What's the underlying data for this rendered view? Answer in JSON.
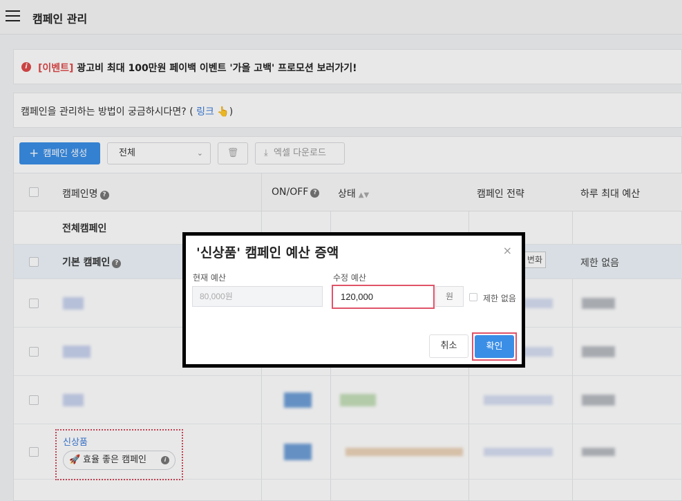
{
  "header": {
    "title": "캠페인 관리",
    "menu_icon": "hamburger-icon"
  },
  "event_banner": {
    "icon": "alert-circle-icon",
    "icon_glyph": "i",
    "tag": "[이벤트]",
    "text": " 광고비 최대 100만원 페이백 이벤트 '가을 고백' 프로모션 보러가기!"
  },
  "help": {
    "text_before": "캠페인을 관리하는 방법이 궁금하시다면? ( ",
    "link": "링크",
    "pointer": "👆",
    "text_after": ")"
  },
  "toolbar": {
    "create_plus": "+",
    "create_label": "캠페인 생성",
    "filter_value": "전체",
    "filter_chevron": "⌄",
    "delete_icon": "🗑",
    "excel_icon": "⤓",
    "excel_label": "엑셀 다운로드"
  },
  "table": {
    "columns": {
      "name": "캠페인명",
      "onoff": "ON/OFF",
      "status": "상태",
      "strategy": "캠페인 전략",
      "daily_budget": "하루 최대 예산"
    },
    "help_glyph": "?",
    "sort_glyph": "▲▼",
    "row_all": {
      "name": "전체캠페인"
    },
    "row_basic": {
      "name": "기본 캠페인",
      "strategy_partial": "변화",
      "daily_budget": "제한 없음"
    },
    "highlight_row": {
      "name": "신상품",
      "badge": "효율 좋은 캠페인",
      "badge_icon": "🚀",
      "badge_info": "i"
    }
  },
  "modal": {
    "title": "'신상품' 캠페인 예산 증액",
    "close": "×",
    "current_label": "현재 예산",
    "current_value": "80,000원",
    "new_label": "수정 예산",
    "new_value": "120,000",
    "unit": "원",
    "no_limit_label": "제한 없음",
    "no_limit_checked": false,
    "cancel_label": "취소",
    "confirm_label": "확인"
  },
  "colors": {
    "primary": "#3a8ee6",
    "highlight_border": "#e05268",
    "event_red": "#e04a4a",
    "link_blue": "#3b7ad8"
  }
}
